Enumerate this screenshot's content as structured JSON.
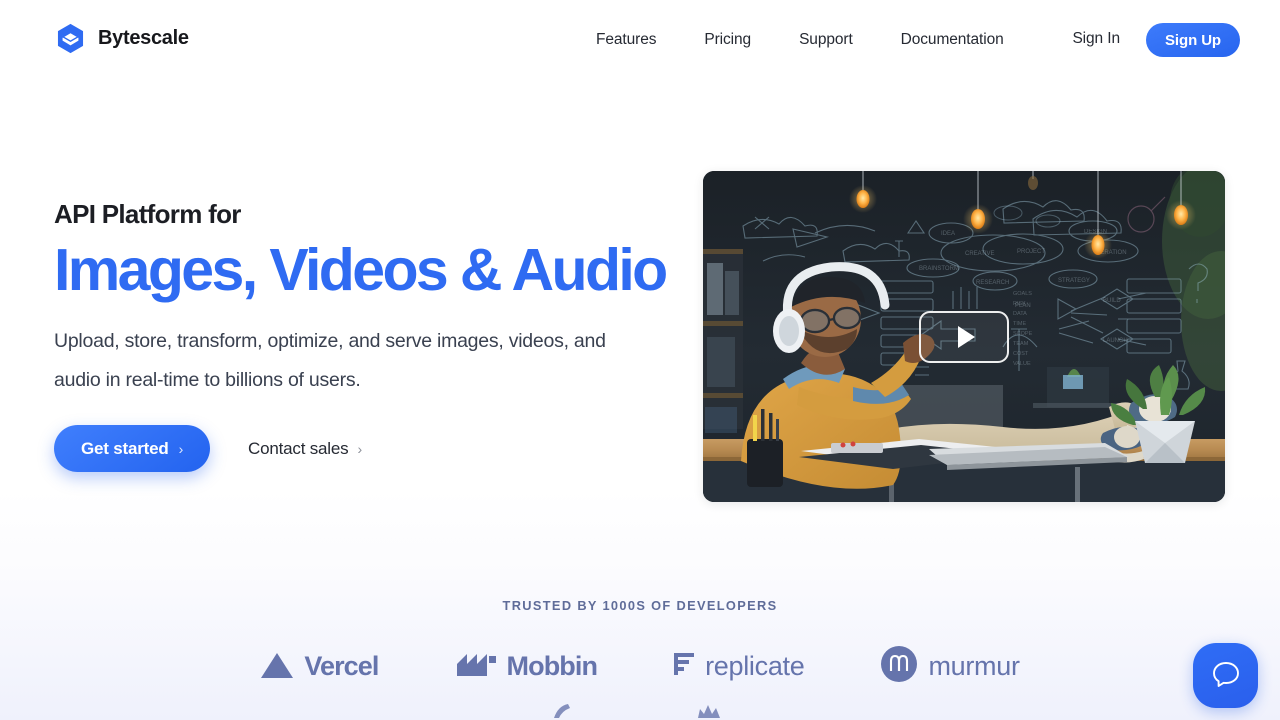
{
  "brand": {
    "name": "Bytescale",
    "logo_icon": "bytescale-hexagon-logo",
    "logo_color": "#2f6bf2"
  },
  "nav": {
    "links": [
      {
        "label": "Features"
      },
      {
        "label": "Pricing"
      },
      {
        "label": "Support"
      },
      {
        "label": "Documentation"
      }
    ],
    "sign_in_label": "Sign In",
    "sign_up_label": "Sign Up"
  },
  "hero": {
    "eyebrow": "API Platform for",
    "headline": "Images, Videos & Audio",
    "headline_color": "#2f6bf2",
    "subcopy": "Upload, store, transform, optimize, and serve images, videos, and audio in real-time to billions of users.",
    "primary_cta": {
      "label": "Get started",
      "chevron": "›"
    },
    "secondary_cta": {
      "label": "Contact sales",
      "chevron": "›"
    }
  },
  "video": {
    "play_icon": "play-triangle-icon",
    "alt": "Man with headphones relaxing at desk in front of chalkboard wall"
  },
  "trusted": {
    "label": "TRUSTED BY 1000S OF DEVELOPERS",
    "logos": [
      {
        "name": "Vercel",
        "icon": "vercel-triangle-icon"
      },
      {
        "name": "Mobbin",
        "icon": "mobbin-m-icon"
      },
      {
        "name": "replicate",
        "icon": "replicate-bars-icon"
      },
      {
        "name": "murmur",
        "icon": "murmur-circle-icon"
      }
    ]
  },
  "chat": {
    "icon": "chat-bubble-icon",
    "color": "#2f6df6"
  }
}
